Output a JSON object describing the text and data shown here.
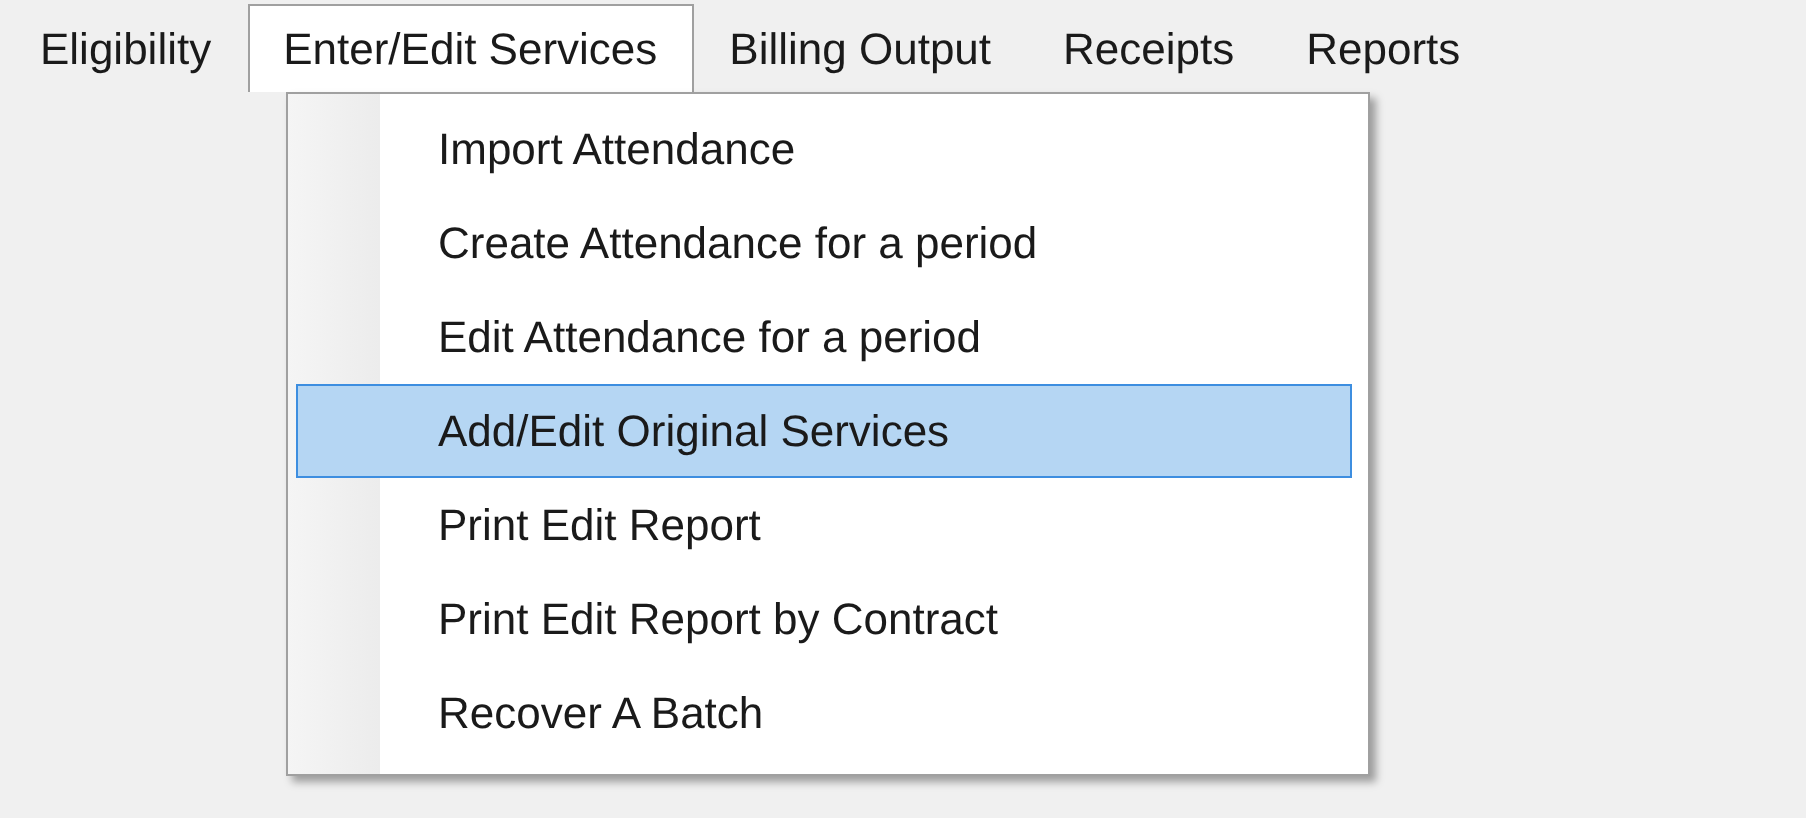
{
  "menu_bar": [
    {
      "label": "Eligibility",
      "selected": false
    },
    {
      "label": "Enter/Edit Services",
      "selected": true
    },
    {
      "label": "Billing Output",
      "selected": false
    },
    {
      "label": "Receipts",
      "selected": false
    },
    {
      "label": "Reports",
      "selected": false
    }
  ],
  "dropdown": {
    "items": [
      {
        "label": "Import Attendance",
        "selected": false
      },
      {
        "label": "Create Attendance for a period",
        "selected": false
      },
      {
        "label": "Edit Attendance for a period",
        "selected": false
      },
      {
        "label": "Add/Edit Original Services",
        "selected": true
      },
      {
        "label": "Print Edit Report",
        "selected": false
      },
      {
        "label": "Print Edit Report by Contract",
        "selected": false
      },
      {
        "label": "Recover A Batch",
        "selected": false
      }
    ]
  }
}
